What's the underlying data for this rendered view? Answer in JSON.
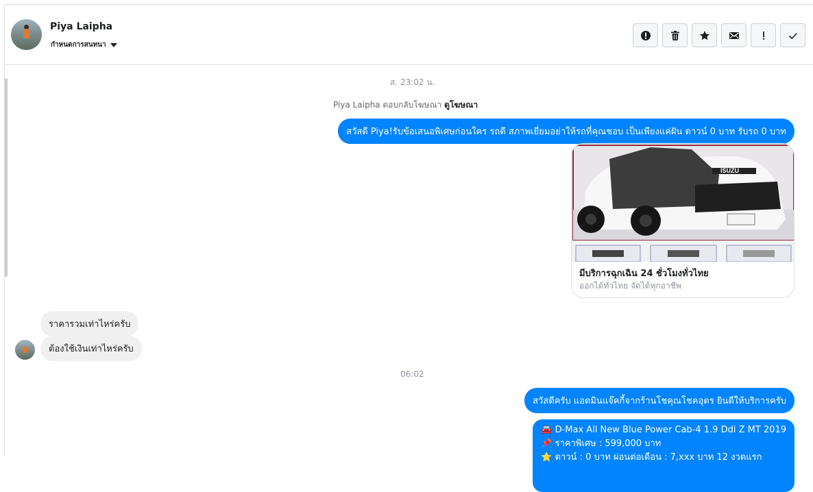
{
  "header": {
    "name": "Piya Laipha",
    "subtitle": "กำหนดการสนทนา"
  },
  "toolbar": {
    "buttons": [
      {
        "icon": "alert-icon"
      },
      {
        "icon": "trash-icon"
      },
      {
        "icon": "star-icon"
      },
      {
        "icon": "envelope-icon"
      },
      {
        "icon": "exclamation-icon"
      },
      {
        "icon": "check-icon"
      }
    ]
  },
  "thread": {
    "timestamp_1": "ส. 23:02 น.",
    "ad_reply_text": "Piya Laipha ตอบกลับโฆษณา",
    "ad_reply_link": "ดูโฆษณา",
    "msg_out_1": "สวัสดี Piya!รับข้อเสนอพิเศษก่อนใคร รถดี สภาพเยี่ยมอย่าให้รถที่คุณชอบ เป็นเพียงแค่ฝัน ดาวน์ 0 บาท รับรถ 0 บาท",
    "card": {
      "title": "มีบริการฉุกเฉิน 24 ชั่วโมงทั่วไทย",
      "subtitle": "ออกได้ทั่วไทย จัดได้ทุกอาชีพ",
      "badge": "ISUZU"
    },
    "msg_in_1": "ราคารวมเท่าไหร่ครับ",
    "msg_in_2": "ต้องใช้เงินเท่าไหร่ครับ",
    "timestamp_2": "06:02",
    "msg_out_2": "สวัสดีครับ แอดมินแจ๊คกี้จากร้านโชคุณโชคอุดร ยินดีให้บริการครับ",
    "msg_out_3_line1": "🚘 D-Max All New Blue Power Cab-4 1.9 Ddi Z MT 2019",
    "msg_out_3_line2": "📌 ราคาพิเศษ : 599,000 บาท",
    "msg_out_3_line3": "⭐ ดาวน์ : 0 บาท ผ่อนต่อเดือน : 7,xxx บาท 12 งวดแรก"
  },
  "colors": {
    "accent": "#0084ff",
    "bubble_in": "#f1f0f0",
    "muted": "#90949c"
  }
}
